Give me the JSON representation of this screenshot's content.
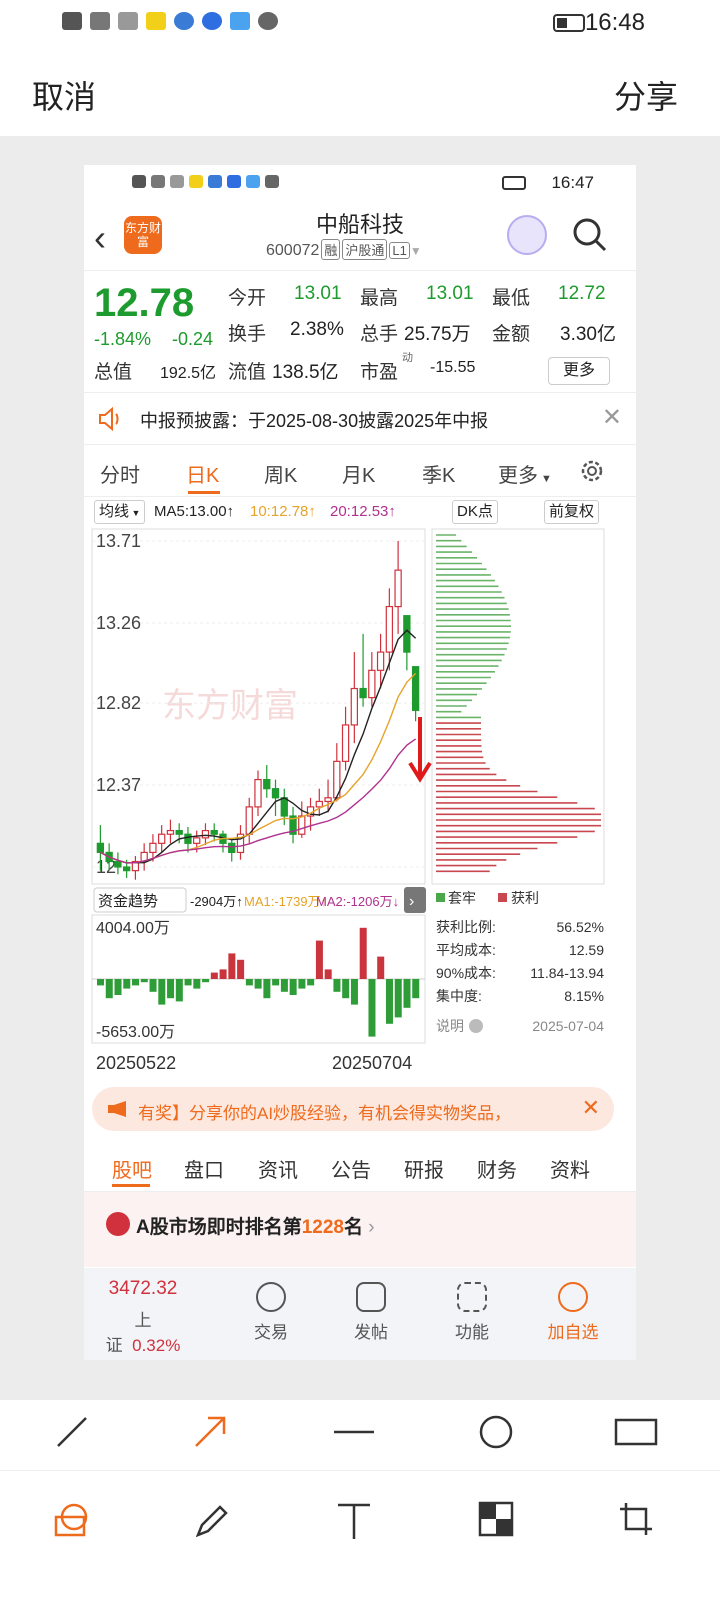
{
  "status": {
    "time": "16:48"
  },
  "topbar": {
    "cancel": "取消",
    "share": "分享"
  },
  "inner": {
    "status_time": "16:47",
    "logo_text": "东方财富",
    "stock_name": "中船科技",
    "stock_code": "600072",
    "tags": [
      "融",
      "沪股通",
      "L1"
    ],
    "quote": {
      "price": "12.78",
      "pct": "-1.84%",
      "change": "-0.24",
      "open_label": "今开",
      "open": "13.01",
      "high_label": "最高",
      "high": "13.01",
      "low_label": "最低",
      "low": "12.72",
      "turnover_label": "换手",
      "turnover": "2.38%",
      "volume_label": "总手",
      "volume": "25.75万",
      "amount_label": "金额",
      "amount": "3.30亿",
      "mcap_label": "总值",
      "mcap": "192.5亿",
      "float_label": "流值",
      "float": "138.5亿",
      "pe_label": "市盈",
      "pe_sup": "动",
      "pe": "-15.55",
      "more": "更多"
    },
    "notice": "中报预披露：于2025-08-30披露2025年中报",
    "period_tabs": [
      "分时",
      "日K",
      "周K",
      "月K",
      "季K",
      "更多"
    ],
    "indicator": {
      "ma_select": "均线",
      "ma5": "MA5:13.00↑",
      "ma10": "10:12.78↑",
      "ma20": "20:12.53↑",
      "dk": "DK点",
      "fq": "前复权"
    },
    "yaxis": [
      "13.71",
      "13.26",
      "12.82",
      "12.37",
      "11.92"
    ],
    "yaxis_last_visible": "12",
    "watermark": "东方财富",
    "fund": {
      "select": "资金趋势",
      "value": "-2904万↑",
      "ma1": "MA1:-1739万↑",
      "ma2": "MA2:-1206万↓",
      "top": "4004.00万",
      "bottom": "-5653.00万",
      "date_start": "20250522",
      "date_end": "20250704"
    },
    "chip": {
      "legend_trap": "套牢",
      "legend_profit": "获利",
      "rows": [
        {
          "label": "获利比例:",
          "value": "56.52%"
        },
        {
          "label": "平均成本:",
          "value": "12.59"
        },
        {
          "label": "90%成本:",
          "value": "11.84-13.94"
        },
        {
          "label": "集中度:",
          "value": "8.15%"
        }
      ],
      "note": "说明",
      "date": "2025-07-04"
    },
    "promo": "有奖】分享你的AI炒股经验，有机会得实物奖品，",
    "bottom_tabs": [
      "股吧",
      "盘口",
      "资讯",
      "公告",
      "研报",
      "财务",
      "资料"
    ],
    "rank": {
      "prefix": "A股市场即时排名第",
      "number": "1228",
      "suffix": "名"
    },
    "footer": {
      "index_value": "3472.32",
      "index_name": "上证",
      "index_pct": "0.32%",
      "trade": "交易",
      "post": "发帖",
      "func": "功能",
      "add": "加自选"
    }
  },
  "colors": {
    "up": "#d0313c",
    "down": "#1e9b2e",
    "accent": "#ee6a1c",
    "ma5": "#222222",
    "ma10": "#e6a32a",
    "ma20": "#b0318f"
  },
  "chart_data": {
    "type": "candlestick",
    "ylim": [
      11.92,
      13.71
    ],
    "series_names": [
      "MA5",
      "MA10",
      "MA20"
    ],
    "candles_note": "daily K from 2025-05-22 to 2025-07-04",
    "candles": [
      [
        12.05,
        12.0,
        12.15,
        11.9
      ],
      [
        12.0,
        11.95,
        12.05,
        11.9
      ],
      [
        11.95,
        11.92,
        12.0,
        11.88
      ],
      [
        11.92,
        11.9,
        11.96,
        11.86
      ],
      [
        11.9,
        11.95,
        11.98,
        11.85
      ],
      [
        11.95,
        12.0,
        12.05,
        11.9
      ],
      [
        12.0,
        12.05,
        12.1,
        11.95
      ],
      [
        12.05,
        12.1,
        12.15,
        12.0
      ],
      [
        12.1,
        12.12,
        12.18,
        12.05
      ],
      [
        12.12,
        12.1,
        12.16,
        12.05
      ],
      [
        12.1,
        12.05,
        12.14,
        12.0
      ],
      [
        12.05,
        12.08,
        12.12,
        12.0
      ],
      [
        12.08,
        12.12,
        12.16,
        12.04
      ],
      [
        12.12,
        12.1,
        12.16,
        12.06
      ],
      [
        12.1,
        12.05,
        12.12,
        12.0
      ],
      [
        12.05,
        12.0,
        12.08,
        11.95
      ],
      [
        12.0,
        12.1,
        12.15,
        11.96
      ],
      [
        12.1,
        12.25,
        12.3,
        12.05
      ],
      [
        12.25,
        12.4,
        12.45,
        12.2
      ],
      [
        12.4,
        12.35,
        12.48,
        12.3
      ],
      [
        12.35,
        12.3,
        12.4,
        12.2
      ],
      [
        12.3,
        12.2,
        12.35,
        12.15
      ],
      [
        12.2,
        12.1,
        12.25,
        12.05
      ],
      [
        12.1,
        12.2,
        12.28,
        12.08
      ],
      [
        12.2,
        12.25,
        12.3,
        12.12
      ],
      [
        12.25,
        12.28,
        12.35,
        12.2
      ],
      [
        12.28,
        12.3,
        12.4,
        12.22
      ],
      [
        12.3,
        12.5,
        12.6,
        12.28
      ],
      [
        12.5,
        12.7,
        12.8,
        12.45
      ],
      [
        12.7,
        12.9,
        13.1,
        12.6
      ],
      [
        12.9,
        12.85,
        13.2,
        12.8
      ],
      [
        12.85,
        13.0,
        13.1,
        12.8
      ],
      [
        13.0,
        13.1,
        13.2,
        12.9
      ],
      [
        13.1,
        13.35,
        13.45,
        13.0
      ],
      [
        13.35,
        13.55,
        13.71,
        13.2
      ],
      [
        13.3,
        13.1,
        13.3,
        13.0
      ],
      [
        13.02,
        12.78,
        13.01,
        12.72
      ]
    ],
    "fund_bars": [
      -2,
      -6,
      -5,
      -3,
      -2,
      -1,
      -4,
      -8,
      -6,
      -7,
      -2,
      -3,
      -1,
      2,
      3,
      8,
      6,
      -2,
      -3,
      -6,
      -2,
      -4,
      -5,
      -3,
      -2,
      12,
      3,
      -4,
      -6,
      -8,
      16,
      -18,
      7,
      -14,
      -12,
      -9,
      -6
    ],
    "fund_ylim": [
      -5653,
      4004
    ],
    "chip_profit_ratio": "56.52%"
  }
}
